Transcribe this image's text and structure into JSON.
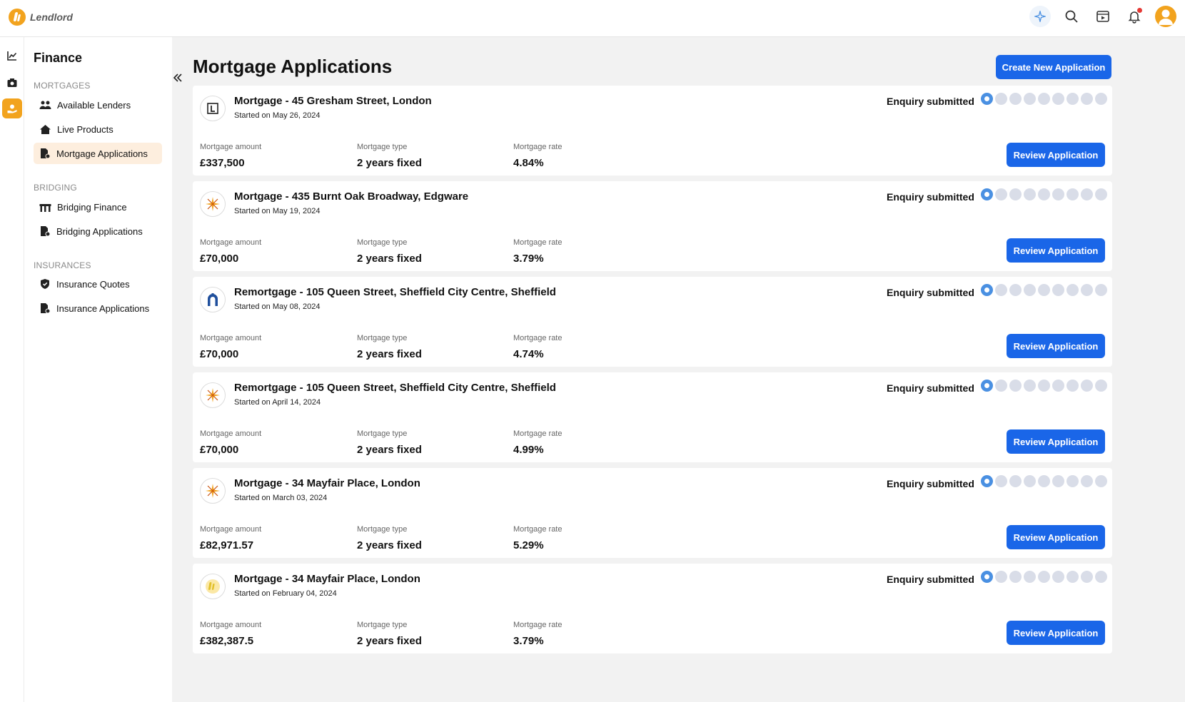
{
  "app": {
    "name": "Lendlord"
  },
  "topbar": {
    "icons": [
      "ai-sparkle-icon",
      "search-icon",
      "video-icon",
      "bell-icon",
      "avatar"
    ]
  },
  "sidebar": {
    "title": "Finance",
    "sections": [
      {
        "label": "MORTGAGES",
        "items": [
          {
            "label": "Available Lenders",
            "icon": "users-icon"
          },
          {
            "label": "Live Products",
            "icon": "house-icon"
          },
          {
            "label": "Mortgage Applications",
            "icon": "document-icon",
            "active": true
          }
        ]
      },
      {
        "label": "BRIDGING",
        "items": [
          {
            "label": "Bridging Finance",
            "icon": "bridge-icon"
          },
          {
            "label": "Bridging Applications",
            "icon": "document-icon"
          }
        ]
      },
      {
        "label": "INSURANCES",
        "items": [
          {
            "label": "Insurance Quotes",
            "icon": "shield-icon"
          },
          {
            "label": "Insurance Applications",
            "icon": "document-icon"
          }
        ]
      }
    ]
  },
  "main": {
    "title": "Mortgage Applications",
    "create_label": "Create New Application",
    "field_labels": {
      "amount": "Mortgage amount",
      "type": "Mortgage type",
      "rate": "Mortgage rate"
    },
    "review_label": "Review Application",
    "applications": [
      {
        "title": "Mortgage - 45 Gresham Street, London",
        "started": "Started on May 26, 2024",
        "status": "Enquiry submitted",
        "amount": "£337,500",
        "type": "2 years fixed",
        "rate": "4.84%",
        "logo": "lloyds-l-icon",
        "progress_step": 1,
        "progress_total": 9
      },
      {
        "title": "Mortgage - 435 Burnt Oak Broadway, Edgware",
        "started": "Started on May 19, 2024",
        "status": "Enquiry submitted",
        "amount": "£70,000",
        "type": "2 years fixed",
        "rate": "3.79%",
        "logo": "star-burst-icon",
        "progress_step": 1,
        "progress_total": 9
      },
      {
        "title": "Remortgage - 105 Queen Street, Sheffield City Centre, Sheffield",
        "started": "Started on May 08, 2024",
        "status": "Enquiry submitted",
        "amount": "£70,000",
        "type": "2 years fixed",
        "rate": "4.74%",
        "logo": "arch-icon",
        "progress_step": 1,
        "progress_total": 9
      },
      {
        "title": "Remortgage - 105 Queen Street, Sheffield City Centre, Sheffield",
        "started": "Started on April 14, 2024",
        "status": "Enquiry submitted",
        "amount": "£70,000",
        "type": "2 years fixed",
        "rate": "4.99%",
        "logo": "star-burst-icon",
        "progress_step": 1,
        "progress_total": 9
      },
      {
        "title": "Mortgage - 34 Mayfair Place, London",
        "started": "Started on March 03, 2024",
        "status": "Enquiry submitted",
        "amount": "£82,971.57",
        "type": "2 years fixed",
        "rate": "5.29%",
        "logo": "star-burst-icon",
        "progress_step": 1,
        "progress_total": 9
      },
      {
        "title": "Mortgage - 34 Mayfair Place, London",
        "started": "Started on February 04, 2024",
        "status": "Enquiry submitted",
        "amount": "£382,387.5",
        "type": "2 years fixed",
        "rate": "3.79%",
        "logo": "lendlord-logo-icon",
        "progress_step": 1,
        "progress_total": 9
      }
    ]
  },
  "colors": {
    "accent": "#1a66e8",
    "brand": "#f2a31e",
    "active_bg": "#fdeede",
    "progress_done": "#4a90e2",
    "progress_todo": "#d9dde8"
  }
}
